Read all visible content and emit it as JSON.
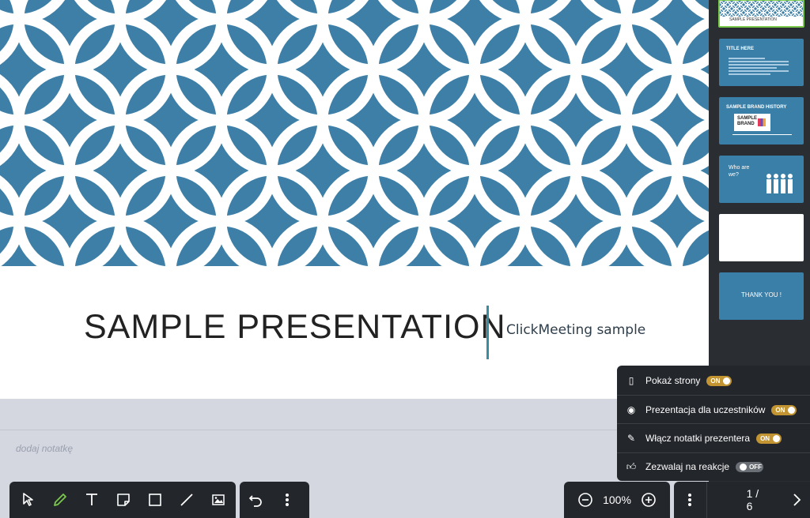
{
  "slide": {
    "title": "SAMPLE PRESENTATION",
    "subtitle": "ClickMeeting sample",
    "pattern_color": "#3d7fa6"
  },
  "notes": {
    "placeholder": "dodaj notatkę"
  },
  "thumbnails": [
    {
      "title": "SAMPLE PRESENTATION",
      "active": true
    },
    {
      "title": "TITLE HERE"
    },
    {
      "title": "SAMPLE BRAND HISTORY",
      "logo_text": "SAMPLE BRAND"
    },
    {
      "title": "Who are we?"
    },
    {
      "title": ""
    },
    {
      "title": "THANK YOU !"
    }
  ],
  "menu": {
    "items": [
      {
        "label": "Pokaż strony",
        "icon": "pages-icon",
        "toggle": "ON"
      },
      {
        "label": "Prezentacja dla uczestników",
        "icon": "eye-icon",
        "toggle": "ON"
      },
      {
        "label": "Włącz notatki prezentera",
        "icon": "notes-icon",
        "toggle": "ON"
      },
      {
        "label": "Zezwalaj na reakcje",
        "icon": "thumbs-up-icon",
        "toggle": "OFF"
      }
    ]
  },
  "toolbar": {
    "tools": [
      "pointer-icon",
      "pencil-icon",
      "text-icon",
      "sticky-note-icon",
      "rectangle-icon",
      "line-icon",
      "image-icon"
    ],
    "undo": "undo-icon",
    "more": "more-vertical-icon"
  },
  "zoom": {
    "value": "100%"
  },
  "pagination": {
    "text": "1 / 6"
  },
  "colors": {
    "accent_green": "#7ac84c",
    "toggle_on": "#c29432",
    "dark_bg": "#23262b"
  }
}
